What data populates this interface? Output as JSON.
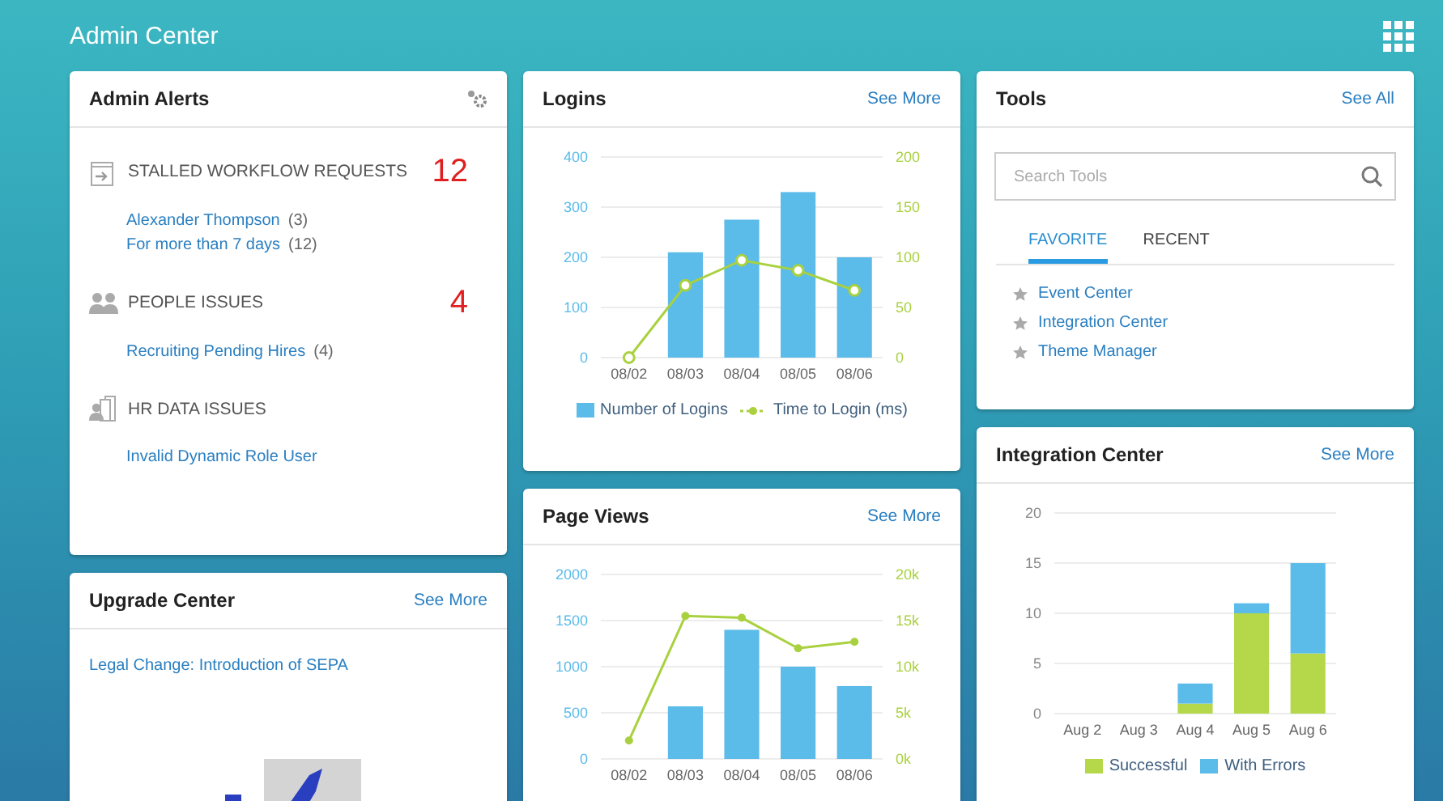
{
  "header": {
    "title": "Admin Center"
  },
  "columns": [
    [
      {
        "kind": "alerts",
        "title": "Admin Alerts",
        "sections": [
          {
            "title": "STALLED WORKFLOW REQUESTS",
            "count": "12",
            "items": [
              {
                "label": "Alexander Thompson",
                "count": "(3)"
              },
              {
                "label": "For more than 7 days",
                "count": "(12)"
              }
            ]
          },
          {
            "title": "PEOPLE ISSUES",
            "count": "4",
            "items": [
              {
                "label": "Recruiting Pending Hires",
                "count": "(4)"
              }
            ]
          },
          {
            "title": "HR DATA ISSUES",
            "items": [
              {
                "label": "Invalid Dynamic Role User"
              }
            ]
          }
        ]
      },
      {
        "kind": "upgrade",
        "title": "Upgrade Center",
        "action": "See More",
        "link": "Legal Change: Introduction of SEPA"
      }
    ],
    [
      {
        "kind": "chart",
        "title": "Logins",
        "action": "See More",
        "chart_data": {
          "type": "bar",
          "categories": [
            "08/02",
            "08/03",
            "08/04",
            "08/05",
            "08/06"
          ],
          "series": [
            {
              "name": "Number of Logins",
              "color": "#5bbbe9",
              "values": [
                0,
                210,
                275,
                330,
                200
              ]
            },
            {
              "name": "Time to Login (ms)",
              "type": "line",
              "axis": "y2",
              "marker": "open-circle",
              "color": "#a9d13f",
              "values": [
                0,
                72,
                97,
                87,
                67
              ]
            }
          ],
          "ylim": [
            0,
            400
          ],
          "yticks": [
            0,
            100,
            200,
            300,
            400
          ],
          "y2lim": [
            0,
            200
          ],
          "y2ticks": [
            0,
            50,
            100,
            150,
            200
          ],
          "grid": true,
          "legend": "bottom"
        }
      },
      {
        "kind": "chart",
        "title": "Page Views",
        "action": "See More",
        "chart_data": {
          "type": "bar",
          "categories": [
            "08/02",
            "08/03",
            "08/04",
            "08/05",
            "08/06"
          ],
          "series": [
            {
              "color": "#5bbbe9",
              "values": [
                0,
                570,
                1400,
                1000,
                790
              ]
            },
            {
              "type": "line",
              "axis": "y2",
              "marker": "circle",
              "color": "#a9d13f",
              "values": [
                2000,
                15500,
                15300,
                12000,
                12700
              ]
            }
          ],
          "ylim": [
            0,
            2000
          ],
          "yticks": [
            0,
            500,
            1000,
            1500,
            2000
          ],
          "y2lim": [
            0,
            20000
          ],
          "y2ticks": [
            {
              "value": 0,
              "label": "0k"
            },
            {
              "value": 5000,
              "label": "5k"
            },
            {
              "value": 10000,
              "label": "10k"
            },
            {
              "value": 15000,
              "label": "15k"
            },
            {
              "value": 20000,
              "label": "20k"
            }
          ],
          "grid": true
        }
      }
    ],
    [
      {
        "kind": "tools",
        "title": "Tools",
        "action": "See All",
        "search": {
          "placeholder": "Search Tools"
        },
        "tabs": [
          {
            "label": "FAVORITE",
            "selected": true
          },
          {
            "label": "RECENT",
            "selected": false
          }
        ],
        "items": [
          "Event Center",
          "Integration Center",
          "Theme Manager"
        ]
      },
      {
        "kind": "chart",
        "title": "Integration Center",
        "action": "See More",
        "chart_data": {
          "type": "bar",
          "stacked": true,
          "categories": [
            "Aug 2",
            "Aug 3",
            "Aug 4",
            "Aug 5",
            "Aug 6"
          ],
          "series": [
            {
              "name": "Successful",
              "color": "#b5d84a",
              "values": [
                0,
                0,
                1,
                10,
                6
              ]
            },
            {
              "name": "With Errors",
              "color": "#5bbbe9",
              "values": [
                0,
                0,
                2,
                1,
                9
              ]
            }
          ],
          "ylim": [
            0,
            20
          ],
          "yticks": [
            0,
            5,
            10,
            15,
            20
          ],
          "grid": true,
          "legend": "bottom"
        }
      }
    ]
  ]
}
